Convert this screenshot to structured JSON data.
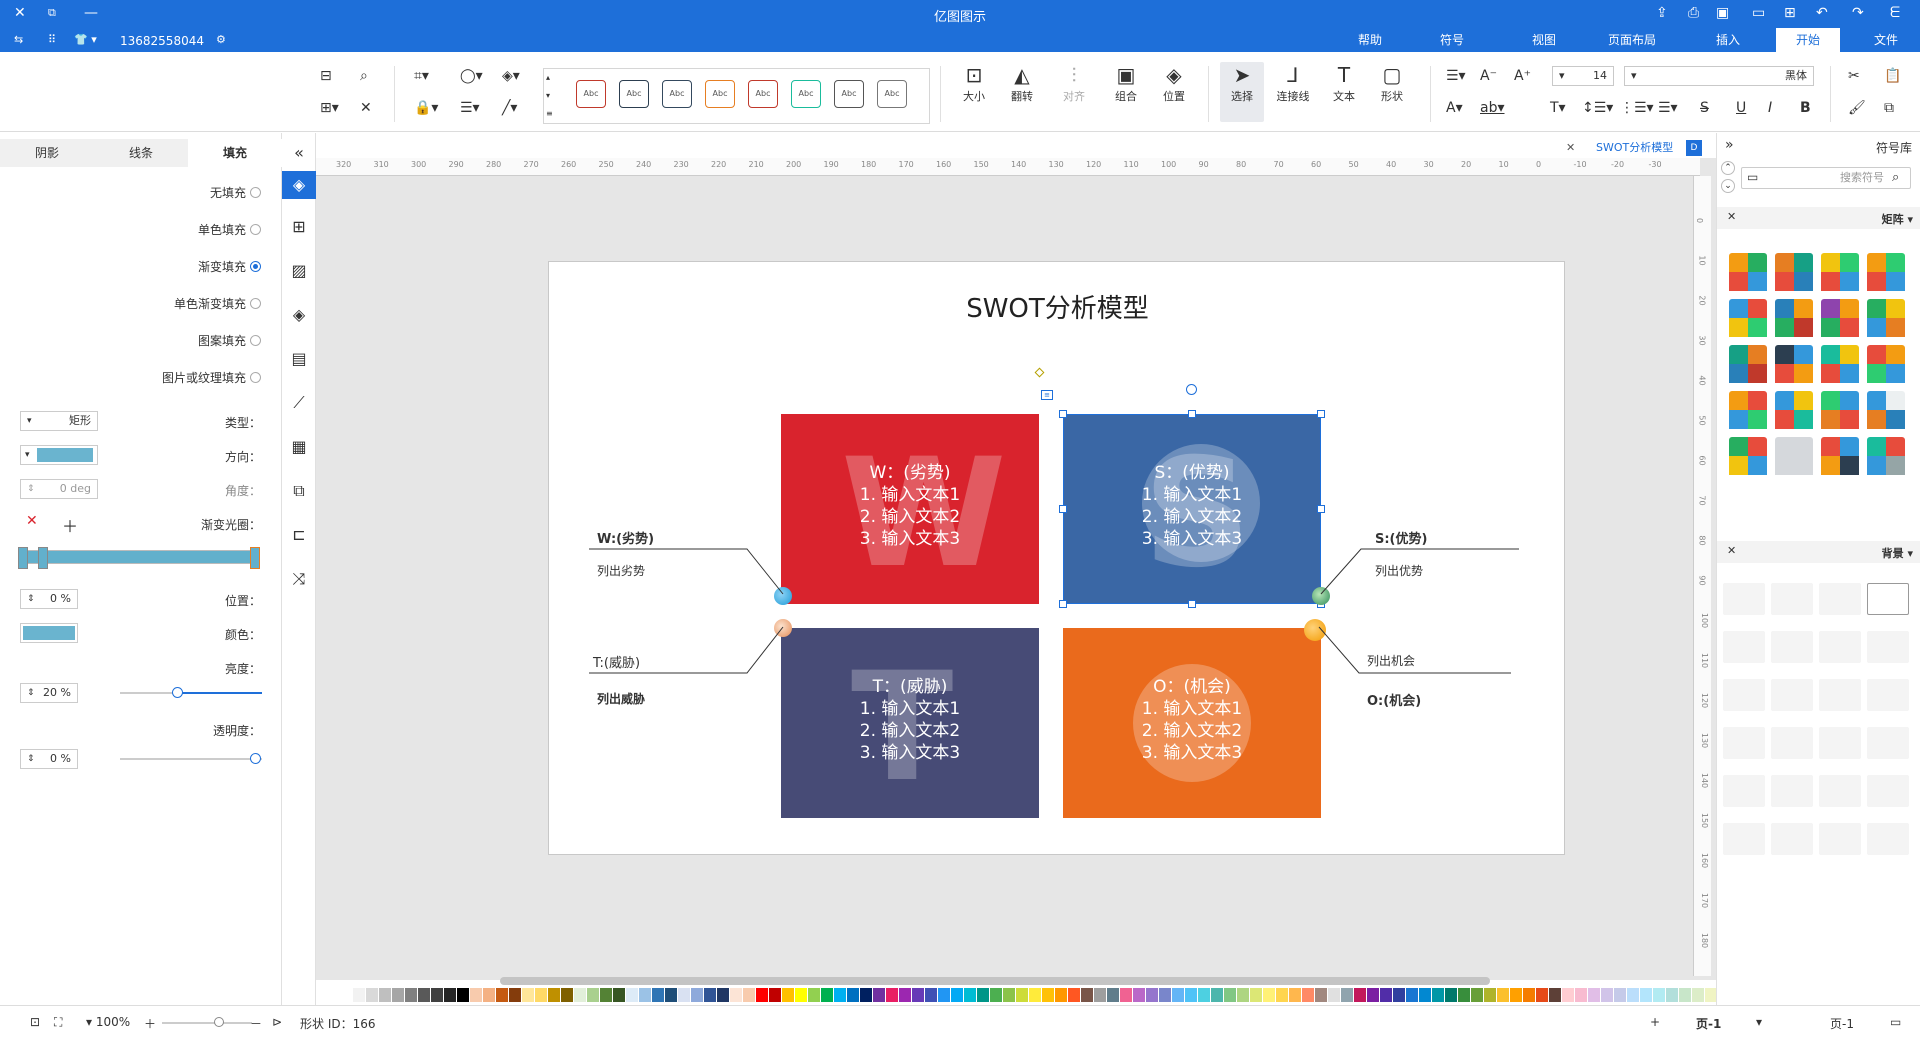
{
  "titlebar": {
    "title": "亿图图示",
    "user": "13682558044"
  },
  "menu": {
    "tabs": [
      "文件",
      "开始",
      "插入",
      "页面布局",
      "视图",
      "符号",
      "帮助"
    ],
    "active": "开始"
  },
  "ribbon": {
    "font_name": "黑体",
    "font_size": "14",
    "tools": {
      "select": "选择",
      "text": "文本",
      "connector": "连接线",
      "shape": "形状",
      "position": "位置",
      "group": "组合",
      "align": "对齐",
      "rotate": "翻转",
      "size": "大小"
    },
    "style_label": "Abc"
  },
  "left_panel": {
    "tabs": [
      "填充",
      "线条",
      "阴影"
    ],
    "fill_options": [
      "无填充",
      "单色填充",
      "渐变填充",
      "单色渐变填充",
      "图案填充",
      "图片或纹理填充"
    ],
    "selected_fill": "渐变填充",
    "type_label": "类型：",
    "type_value": "矩形",
    "direction_label": "方向：",
    "angle_label": "角度：",
    "angle_value": "0 deg",
    "aperture_label": "渐变光圈：",
    "position_label": "位置：",
    "position_value": "0 %",
    "color_label": "颜色：",
    "brightness_label": "亮度：",
    "brightness_value": "20 %",
    "transparency_label": "透明度：",
    "transparency_value": "0 %"
  },
  "canvas": {
    "doc_tab": "SWOT分析模型",
    "title": "SWOT分析模型",
    "ruler_top": [
      "320",
      "310",
      "300",
      "290",
      "280",
      "270",
      "260",
      "250",
      "240",
      "230",
      "220",
      "210",
      "200",
      "190",
      "180",
      "170",
      "160",
      "150",
      "140",
      "130",
      "120",
      "110",
      "100",
      "90",
      "80",
      "70",
      "60",
      "50",
      "40",
      "30",
      "20",
      "10",
      "0",
      "-10",
      "-20",
      "-30"
    ],
    "ruler_right": [
      "0",
      "10",
      "20",
      "30",
      "40",
      "50",
      "60",
      "70",
      "80",
      "90",
      "100",
      "110",
      "120",
      "130",
      "140",
      "150",
      "160",
      "170",
      "180"
    ],
    "quadrants": {
      "w": {
        "letter": "W",
        "header": "W：(劣势)",
        "l1": "1. 输入文本1",
        "l2": "2. 输入文本2",
        "l3": "3. 输入文本3",
        "color": "#d9232d"
      },
      "s": {
        "letter": "S",
        "header": "S：(优势)",
        "l1": "1. 输入文本1",
        "l2": "2. 输入文本2",
        "l3": "3. 输入文本3",
        "color": "#3a67a5"
      },
      "t": {
        "letter": "T",
        "header": "T：(威胁)",
        "l1": "1. 输入文本1",
        "l2": "2. 输入文本2",
        "l3": "3. 输入文本3",
        "color": "#474b76"
      },
      "o": {
        "letter": "O",
        "header": "O：(机会)",
        "l1": "1. 输入文本1",
        "l2": "2. 输入文本2",
        "l3": "3. 输入文本3",
        "color": "#ea6a1c"
      }
    },
    "labels": {
      "w_title": "W:(劣势)",
      "w_sub": "列出劣势",
      "s_title": "S:(优势)",
      "s_sub": "列出优势",
      "t_title": "T:(威胁)",
      "t_sub": "列出威胁",
      "o_title": "O:(机会)",
      "o_sub": "列出机会"
    }
  },
  "right_panel": {
    "title": "符号库",
    "search_placeholder": "搜索符号",
    "section_matrix": "矩阵",
    "section_background": "背景"
  },
  "status": {
    "page_left": "页-1",
    "page_tab": "页-1",
    "add_page": "+",
    "shape_id": "形状 ID：166",
    "zoom": "100%"
  }
}
